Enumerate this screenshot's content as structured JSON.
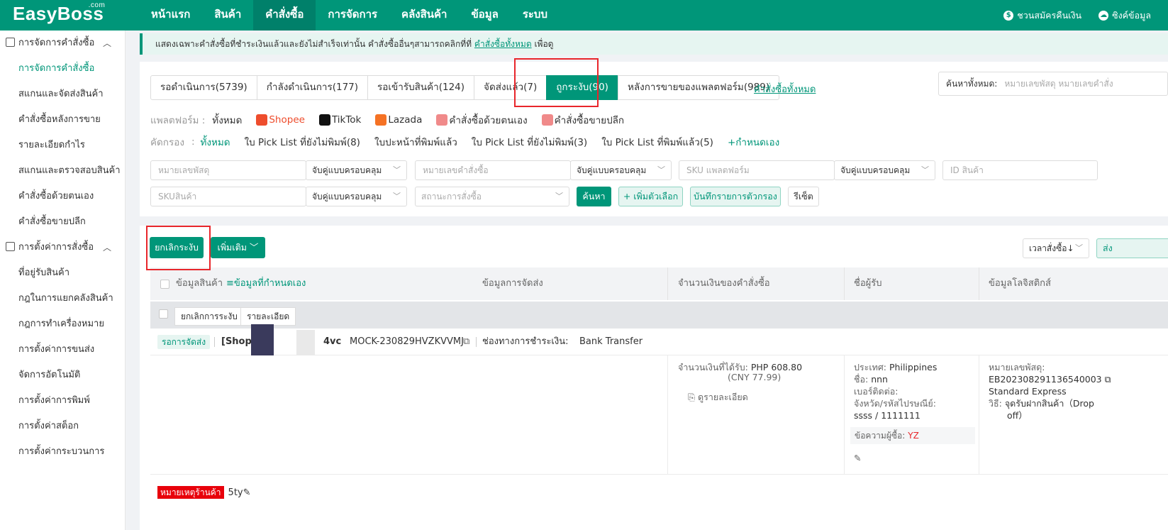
{
  "header": {
    "logo": "EasyBoss",
    "logo_suffix": ".com",
    "nav": [
      "หน้าแรก",
      "สินค้า",
      "คำสั่งซื้อ",
      "การจัดการ",
      "คลังสินค้า",
      "ข้อมูล",
      "ระบบ"
    ],
    "nav_active_index": 2,
    "refund_link": "ชวนสมัครคืนเงิน",
    "sync_link": "ซิงค์ข้อมูล"
  },
  "sidebar": {
    "group1": "การจัดการคำสั่งซื้อ",
    "group1_items": [
      "การจัดการคำสั่งซื้อ",
      "สแกนและจัดส่งสินค้า",
      "คำสั่งซื้อหลังการขาย",
      "รายละเอียดกำไร",
      "สแกนและตรวจสอบสินค้า",
      "คำสั่งซื้อด้วยตนเอง",
      "คำสั่งซื้อขายปลีก"
    ],
    "group2": "การตั้งค่าการสั่งซื้อ",
    "group2_items": [
      "ที่อยู่รับสินค้า",
      "กฎในการแยกคลังสินค้า",
      "กฎการทำเครื่องหมาย",
      "การตั้งค่าการขนส่ง",
      "จัดการอัตโนมัติ",
      "การตั้งค่าการพิมพ์",
      "การตั้งค่าสต็อก",
      "การตั้งค่ากระบวนการ"
    ]
  },
  "notice": {
    "text": "แสดงเฉพาะคำสั่งซื้อที่ชำระเงินแล้วและยังไม่สำเร็จเท่านั้น คำสั่งซื้ออื่นๆสามารถคลิกที่ที่",
    "link": "คำสั่งซื้อทั้งหมด",
    "suffix": "เพื่อดู"
  },
  "tabs": [
    "รอดำเนินการ(5739)",
    "กำลังดำเนินการ(177)",
    "รอเข้ารับสินค้า(124)",
    "จัดส่งแล้ว(7)",
    "ถูกระงับ(90)",
    "หลังการขายของแพลตฟอร์ม(989)"
  ],
  "tab_active_index": 4,
  "all_orders_link": "คำสั่งซื้อทั้งหมด",
  "search_all": {
    "label": "ค้นหาทั้งหมด:",
    "placeholder": "หมายเลขพัสดุ หมายเลขคำสั่ง"
  },
  "platform_filter": {
    "label": "แพลตฟอร์ม :",
    "options": [
      "ทั้งหมด",
      "Shopee",
      "TikTok",
      "Lazada",
      "คำสั่งซื้อด้วยตนเอง",
      "คำสั่งซื้อขายปลีก"
    ]
  },
  "screen_filter": {
    "label": "คัดกรอง",
    "colon": ":",
    "options": [
      "ทั้งหมด",
      "ใบ Pick List ที่ยังไม่พิมพ์(8)",
      "ใบปะหน้าที่พิมพ์แล้ว",
      "ใบ Pick List ที่ยังไม่พิมพ์(3)",
      "ใบ Pick List ที่พิมพ์แล้ว(5)",
      "+กำหนดเอง"
    ]
  },
  "search_fields": {
    "tracking_placeholder": "หมายเลขพัสดุ",
    "order_no_placeholder": "หมายเลขคำสั่งซื้อ",
    "platform_sku_placeholder": "SKU แพลตฟอร์ม",
    "product_id_placeholder": "ID สินค้า",
    "sku_placeholder": "SKUสินค้า",
    "order_status_placeholder": "สถานะการสั่งซื้อ",
    "match_mode": "จับคู่แบบครอบคลุม"
  },
  "buttons": {
    "search": "ค้นหา",
    "add_option": "+ เพิ่มตัวเลือก",
    "save_filter": "บันทึกรายการตัวกรอง",
    "reset": "รีเซ็ต",
    "unsuspend": "ยกเลิกระงับ",
    "more": "เพิ่มเติม",
    "sort": "เวลาสั่งซื้อ↓",
    "right_cut": "ส่ง"
  },
  "table": {
    "headers": [
      "ข้อมูลสินค้า",
      "≡ข้อมูลที่กำหนดเอง",
      "ข้อมูลการจัดส่ง",
      "จำนวนเงินของคำสั่งซื้อ",
      "ชื่อผู้รับ",
      "ข้อมูลโลจิสติกส์"
    ],
    "sub_buttons": [
      "ยกเลิกการระงับ",
      "รายละเอียด"
    ]
  },
  "order": {
    "status": "รอการจัดส่ง",
    "shop_prefix": "[Shope",
    "shop_suffix": "4vc",
    "order_id": "MOCK-230829HVZKVVMJ",
    "payment_label": "ช่องทางการชำระเงิน:",
    "payment_value": "Bank Transfer",
    "amount_label": "จำนวนเงินที่ได้รับ:",
    "amount_value": "PHP 608.80",
    "amount_cny": "(CNY 77.99)",
    "detail_link": "ดูรายละเอียด",
    "country_label": "ประเทศ:",
    "country_value": "Philippines",
    "name_label": "ชื่อ:",
    "name_value": "nnn",
    "phone_label": "เบอร์ติดต่อ:",
    "province_label": "จังหวัด/รหัสไปรษณีย์:",
    "province_value": "ssss / 1111111",
    "buyer_msg_label": "ข้อความผู้ซื้อ:",
    "buyer_msg_value": "YZ",
    "tracking_label": "หมายเลขพัสดุ:",
    "tracking_value": "EB202308291136540003",
    "shipping_method": "Standard Express",
    "method_label": "วิธี:",
    "method_value_1": "จุดรับฝากสินค้า（Drop",
    "method_value_2": "off）",
    "shop_note_label": "หมายเหตุร้านค้า",
    "shop_note_value": "5ty"
  },
  "colors": {
    "brand": "#009679",
    "highlight_box": "#e8262b"
  }
}
